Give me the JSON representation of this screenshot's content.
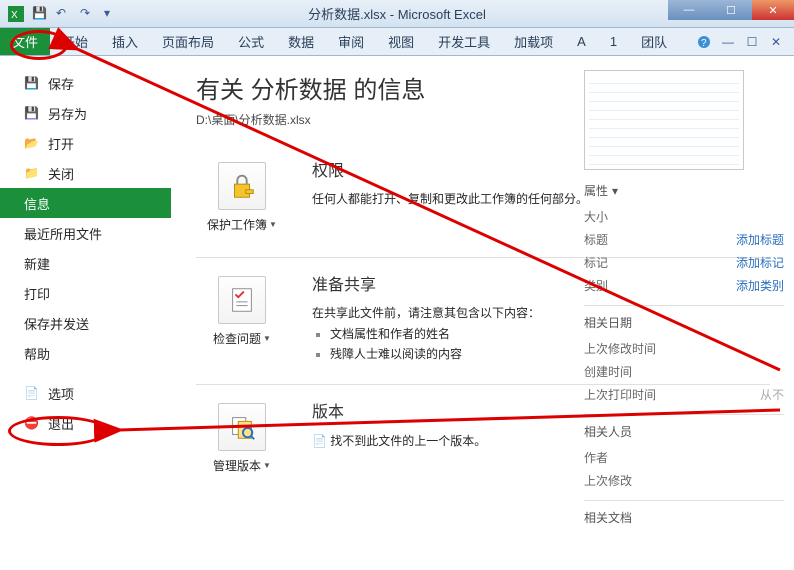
{
  "titlebar": {
    "title": "分析数据.xlsx - Microsoft Excel"
  },
  "winbtn": {
    "min": "—",
    "max": "☐",
    "close": "✕"
  },
  "ribbon": {
    "file": "文件",
    "tabs": [
      "开始",
      "插入",
      "页面布局",
      "公式",
      "数据",
      "审阅",
      "视图",
      "开发工具",
      "加载项",
      "A",
      "1",
      "团队"
    ]
  },
  "sidebar": {
    "save": "保存",
    "saveas": "另存为",
    "open": "打开",
    "close": "关闭",
    "info": "信息",
    "recent": "最近所用文件",
    "new": "新建",
    "print": "打印",
    "sendsave": "保存并发送",
    "help": "帮助",
    "options": "选项",
    "exit": "退出"
  },
  "content": {
    "title": "有关 分析数据 的信息",
    "path": "D:\\桌面\\分析数据.xlsx",
    "perm": {
      "btn": "保护工作簿",
      "heading": "权限",
      "desc": "任何人都能打开、复制和更改此工作簿的任何部分。"
    },
    "prepare": {
      "btn": "检查问题",
      "heading": "准备共享",
      "desc": "在共享此文件前，请注意其包含以下内容：",
      "li1": "文档属性和作者的姓名",
      "li2": "残障人士难以阅读的内容"
    },
    "versions": {
      "btn": "管理版本",
      "heading": "版本",
      "desc": "找不到此文件的上一个版本。"
    }
  },
  "props": {
    "heading1": "属性",
    "size": "大小",
    "title": "标题",
    "title_v": "添加标题",
    "tag": "标记",
    "tag_v": "添加标记",
    "cat": "类别",
    "cat_v": "添加类别",
    "heading2": "相关日期",
    "mod": "上次修改时间",
    "created": "创建时间",
    "printed": "上次打印时间",
    "printed_v": "从不",
    "heading3": "相关人员",
    "author": "作者",
    "lastmod2": "上次修改",
    "heading4": "相关文档"
  }
}
